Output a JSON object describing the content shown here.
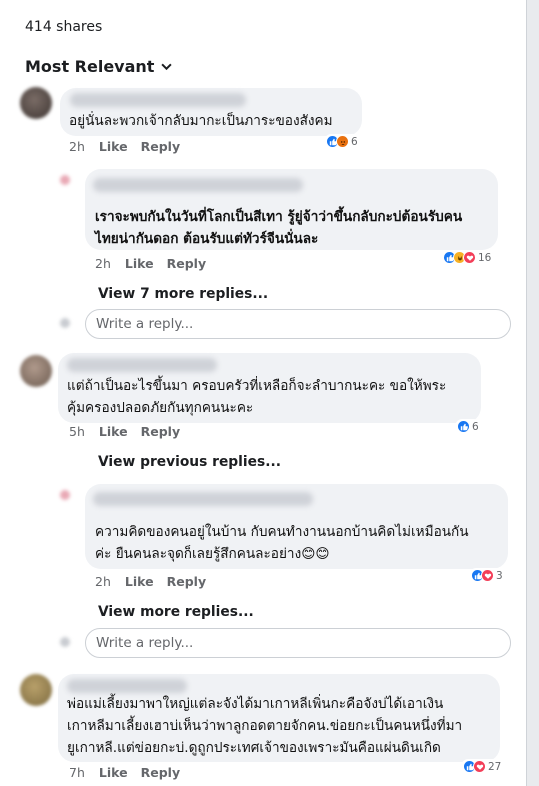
{
  "header": {
    "shares": "414 shares",
    "sort_label": "Most Relevant"
  },
  "comments": [
    {
      "text_lines": [
        "อยู่นั่นละพวกเจ้ากลับมากะเป็นภาระของสังคม"
      ],
      "time": "2h",
      "like": "Like",
      "reply": "Reply",
      "reactions": [
        "like-icon",
        "angry-icon"
      ],
      "reaction_count": "6"
    },
    {
      "text_lines": [
        "เราจะพบกันในวันที่โลกเป็นสีเทา รู้ยู่จ้าว่าขึ้นกลับกะบ่ต้อนรับคน",
        "ไทยน่ากันดอก ต้อนรับแต่ทัวร์จีนนั่นละ"
      ],
      "time": "2h",
      "like": "Like",
      "reply": "Reply",
      "reactions": [
        "like-icon",
        "haha-icon",
        "love-icon"
      ],
      "reaction_count": "16",
      "view_more": "View 7 more replies...",
      "reply_placeholder": "Write a reply..."
    },
    {
      "text_lines": [
        "แต่ถ้าเป็นอะไรขึ้นมา ครอบครัวที่เหลือก็จะลำบากนะคะ ขอให้พระ",
        "คุ้มครองปลอดภัยกันทุกคนนะคะ"
      ],
      "time": "5h",
      "like": "Like",
      "reply": "Reply",
      "reactions": [
        "like-icon"
      ],
      "reaction_count": "6",
      "view_previous": "View previous replies..."
    },
    {
      "text_lines": [
        "ความคิดของคนอยู่ในบ้าน กับคนทำงานนอกบ้านคิดไม่เหมือนกัน",
        "ค่ะ ยืนคนละจุดก็เลยรู้สึกคนละอย่าง😊😊"
      ],
      "time": "2h",
      "like": "Like",
      "reply": "Reply",
      "reactions": [
        "like-icon",
        "love-icon"
      ],
      "reaction_count": "3",
      "view_more": "View more replies...",
      "reply_placeholder": "Write a reply..."
    },
    {
      "text_lines": [
        "พ่อแม่เลี้ยงมาพาใหญ่แต่ละจังได้มาเกาหลีเพิ่นกะคือจังบ่ได้เอาเงิน",
        "เกาหลีมาเลี้ยงเฮาบ่เห็นว่าพาลูกอดตายจักคน.ข่อยกะเป็นคนหนึ่งที่มา",
        "ยูเกาหลี.แต่ข่อยกะบ่.ดูถูกประเทศเจ้าของเพราะมันคือแผ่นดินเกิด"
      ],
      "time": "7h",
      "like": "Like",
      "reply": "Reply",
      "reactions": [
        "like-icon",
        "love-icon"
      ],
      "reaction_count": "27"
    }
  ]
}
